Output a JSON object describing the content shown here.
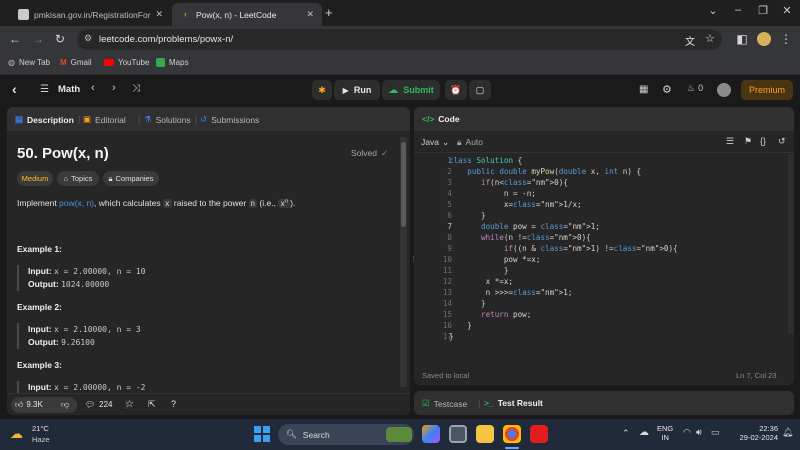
{
  "browser": {
    "tabs": [
      {
        "title": "pmkisan.gov.in/RegistrationFor",
        "active": false
      },
      {
        "title": "Pow(x, n) - LeetCode",
        "active": true
      }
    ],
    "url": "leetcode.com/problems/powx-n/",
    "bookmarks": [
      "New Tab",
      "Gmail",
      "YouTube",
      "Maps"
    ]
  },
  "lc_header": {
    "problem_list": "Math",
    "run_label": "Run",
    "submit_label": "Submit",
    "streak_count": "0",
    "premium_label": "Premium"
  },
  "left_panel": {
    "tabs": [
      "Description",
      "Editorial",
      "Solutions",
      "Submissions"
    ],
    "title": "50. Pow(x, n)",
    "status": "Solved",
    "difficulty": "Medium",
    "topics_label": "Topics",
    "companies_label": "Companies",
    "desc_prefix": "Implement ",
    "desc_link": "pow(x, n)",
    "desc_mid": ", which calculates ",
    "desc_x": "x",
    "desc_mid2": " raised to the power ",
    "desc_n": "n",
    "desc_suffix": " (i.e., ",
    "desc_xn": "x",
    "desc_sup": "n",
    "desc_end": ").",
    "examples": [
      {
        "heading": "Example 1:",
        "input_label": "Input:",
        "input": "x = 2.00000, n = 10",
        "output_label": "Output:",
        "output": "1024.00000"
      },
      {
        "heading": "Example 2:",
        "input_label": "Input:",
        "input": "x = 2.10000, n = 3",
        "output_label": "Output:",
        "output": "9.26100"
      },
      {
        "heading": "Example 3:",
        "input_label": "Input:",
        "input": "x = 2.00000, n = -2"
      }
    ],
    "likes": "9.3K",
    "comments": "224"
  },
  "code_panel": {
    "title": "Code",
    "language": "Java",
    "auto_label": "Auto",
    "lines": [
      "class Solution {",
      "    public double myPow(double x, int n) {",
      "       if(n<0){",
      "            n = -n;",
      "            x=1/x;",
      "       }",
      "       double pow = 1;",
      "       while(n !=0){",
      "            if((n & 1) !=0){",
      "            pow *=x;",
      "            }",
      "        x *=x;",
      "        n >>>=1;",
      "       }",
      "       return pow;",
      "    }",
      "}"
    ],
    "saved_status": "Saved to local",
    "cursor_pos": "Ln 7, Col 23"
  },
  "bottom_panel": {
    "tabs": [
      "Testcase",
      "Test Result"
    ]
  },
  "taskbar": {
    "temperature": "21°C",
    "weather": "Haze",
    "search_placeholder": "Search",
    "lang_line1": "ENG",
    "lang_line2": "IN",
    "time": "22:36",
    "date": "29-02-2024"
  }
}
